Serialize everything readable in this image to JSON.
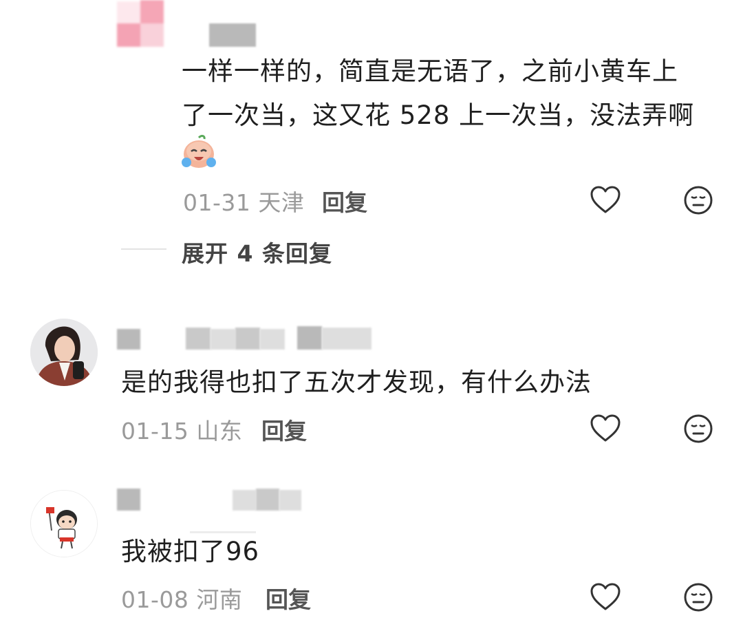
{
  "comments": [
    {
      "text_line1": "一样一样的，简直是无语了，之前小黄车上",
      "text_line2": "了一次当，这又花 528 上一次当，没法弄啊",
      "emoji": "crying-laughing-face-icon",
      "date": "01-31",
      "location": "天津",
      "reply_label": "回复",
      "expand_label": "展开 4 条回复"
    },
    {
      "text": "是的我得也扣了五次才发现，有什么办法",
      "date": "01-15",
      "location": "山东",
      "reply_label": "回复"
    },
    {
      "text": "我被扣了96",
      "date": "01-08",
      "location": "河南",
      "reply_label": "回复"
    }
  ],
  "icons": {
    "like": "heart-icon",
    "dislike": "neutral-face-icon"
  },
  "colors": {
    "text": "#1f1f1f",
    "meta": "#9a9a9a",
    "icon": "#333333",
    "blur_pink": "#f3a8b8"
  }
}
